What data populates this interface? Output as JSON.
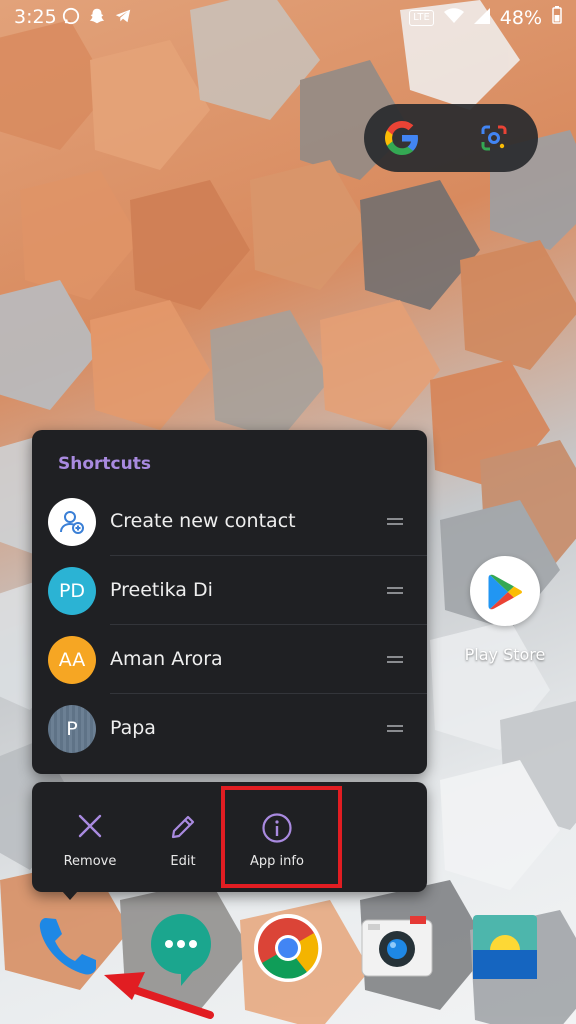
{
  "status_bar": {
    "time": "3:25",
    "battery": "48%",
    "network_badge": "LTE",
    "icons": [
      "whatsapp-icon",
      "snapchat-icon",
      "telegram-icon",
      "wifi-icon",
      "signal-icon",
      "battery-icon"
    ]
  },
  "search_widget": {
    "icons": [
      "google-g-icon",
      "google-lens-icon"
    ]
  },
  "shortcuts_menu": {
    "title": "Shortcuts",
    "items": [
      {
        "label": "Create new contact",
        "avatar_text": "",
        "avatar_color": "#ffffff",
        "icon": "add-contact-icon"
      },
      {
        "label": "Preetika Di",
        "avatar_text": "PD",
        "avatar_color": "#2bb3d4"
      },
      {
        "label": "Aman Arora",
        "avatar_text": "AA",
        "avatar_color": "#f6a623"
      },
      {
        "label": "Papa",
        "avatar_text": "P",
        "avatar_color": "#5f7387"
      }
    ]
  },
  "actions": [
    {
      "label": "Remove",
      "icon": "close-icon"
    },
    {
      "label": "Edit",
      "icon": "pencil-icon"
    },
    {
      "label": "App info",
      "icon": "info-icon"
    }
  ],
  "home_apps": [
    {
      "label": "Play Store",
      "icon": "play-store-icon"
    }
  ],
  "dock": [
    {
      "icon": "phone-icon"
    },
    {
      "icon": "messages-icon"
    },
    {
      "icon": "chrome-icon"
    },
    {
      "icon": "camera-icon"
    },
    {
      "icon": "gallery-icon"
    }
  ],
  "colors": {
    "panel_bg": "#1f2023",
    "accent_purple": "#a98ae0",
    "highlight_red": "#e11d22",
    "annotation_arrow": "#e11d22"
  }
}
